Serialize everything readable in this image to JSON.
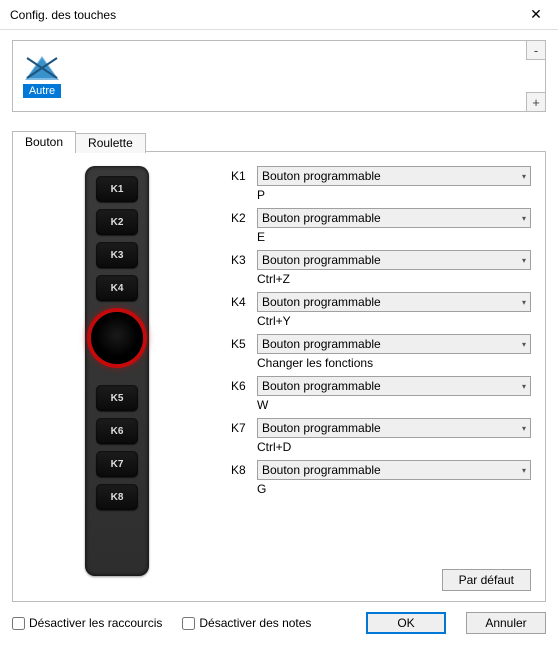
{
  "window": {
    "title": "Config. des touches",
    "close_glyph": "✕"
  },
  "profile": {
    "label": "Autre",
    "minus": "-",
    "plus": "+"
  },
  "tabs": {
    "button": "Bouton",
    "roulette": "Roulette"
  },
  "remote_buttons_top": [
    "K1",
    "K2",
    "K3",
    "K4"
  ],
  "remote_buttons_bottom": [
    "K5",
    "K6",
    "K7",
    "K8"
  ],
  "assignments": [
    {
      "key": "K1",
      "action": "Bouton programmable",
      "value": "P"
    },
    {
      "key": "K2",
      "action": "Bouton programmable",
      "value": "E"
    },
    {
      "key": "K3",
      "action": "Bouton programmable",
      "value": "Ctrl+Z"
    },
    {
      "key": "K4",
      "action": "Bouton programmable",
      "value": "Ctrl+Y"
    },
    {
      "key": "K5",
      "action": "Bouton programmable",
      "value": "Changer les fonctions"
    },
    {
      "key": "K6",
      "action": "Bouton programmable",
      "value": "W"
    },
    {
      "key": "K7",
      "action": "Bouton programmable",
      "value": "Ctrl+D"
    },
    {
      "key": "K8",
      "action": "Bouton programmable",
      "value": "G"
    }
  ],
  "buttons": {
    "defaults": "Par défaut",
    "ok": "OK",
    "cancel": "Annuler"
  },
  "checkboxes": {
    "disable_shortcuts": "Désactiver les raccourcis",
    "disable_notes": "Désactiver des notes"
  }
}
